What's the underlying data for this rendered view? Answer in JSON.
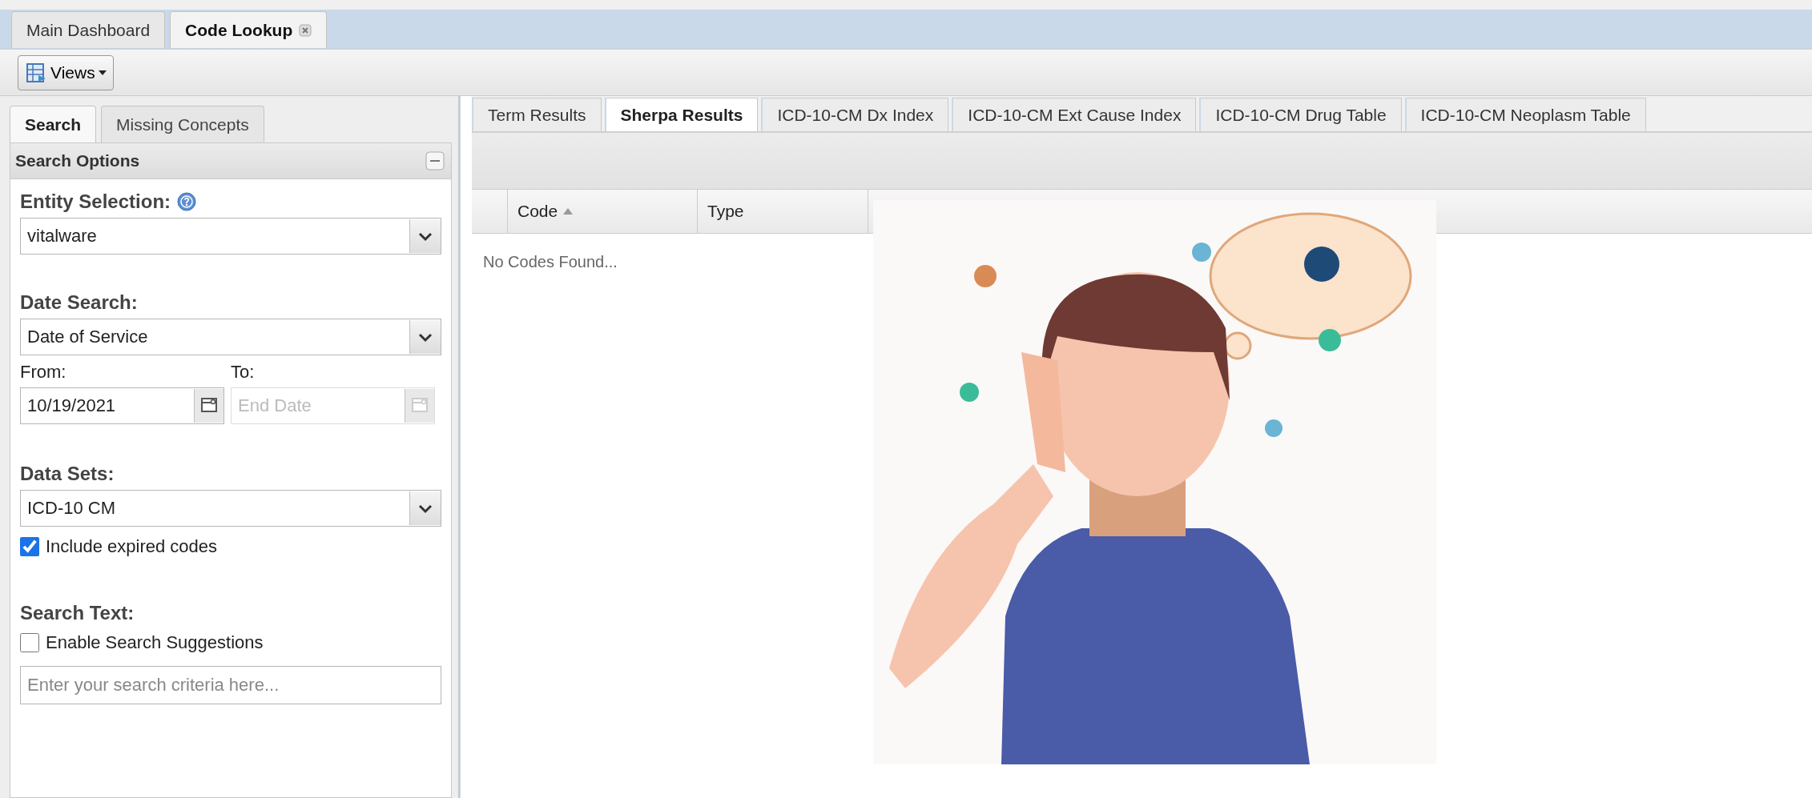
{
  "top_tabs": [
    {
      "label": "Main Dashboard",
      "selected": false,
      "closable": false
    },
    {
      "label": "Code Lookup",
      "selected": true,
      "closable": true
    }
  ],
  "toolbar": {
    "views_button": "Views"
  },
  "left_tabs": [
    {
      "label": "Search",
      "selected": true
    },
    {
      "label": "Missing Concepts",
      "selected": false
    }
  ],
  "search_options": {
    "title": "Search Options",
    "entity_label": "Entity Selection:",
    "entity_value": "vitalware",
    "date_label": "Date Search:",
    "date_value": "Date of Service",
    "date_fields": [
      {
        "label": "From:",
        "value": "10/19/2021",
        "disabled": false
      },
      {
        "label": "To:",
        "placeholder": "End Date",
        "disabled": true
      }
    ],
    "datasets_label": "Data Sets:",
    "datasets_value": "ICD-10 CM",
    "include_expired": {
      "label": "Include expired codes",
      "checked": true
    },
    "search_text_label": "Search Text:",
    "suggestions": {
      "label": "Enable Search Suggestions",
      "checked": false
    },
    "search_placeholder": "Enter your search criteria here..."
  },
  "result_tabs": [
    {
      "label": "Term Results",
      "selected": false
    },
    {
      "label": "Sherpa Results",
      "selected": true
    },
    {
      "label": "ICD-10-CM Dx Index",
      "selected": false
    },
    {
      "label": "ICD-10-CM Ext Cause Index",
      "selected": false
    },
    {
      "label": "ICD-10-CM Drug Table",
      "selected": false
    },
    {
      "label": "ICD-10-CM Neoplasm Table",
      "selected": false
    }
  ],
  "grid": {
    "columns": [
      {
        "label": "Code",
        "sorted": true
      },
      {
        "label": "Type",
        "sorted": false
      }
    ],
    "empty_text": "No Codes Found..."
  }
}
